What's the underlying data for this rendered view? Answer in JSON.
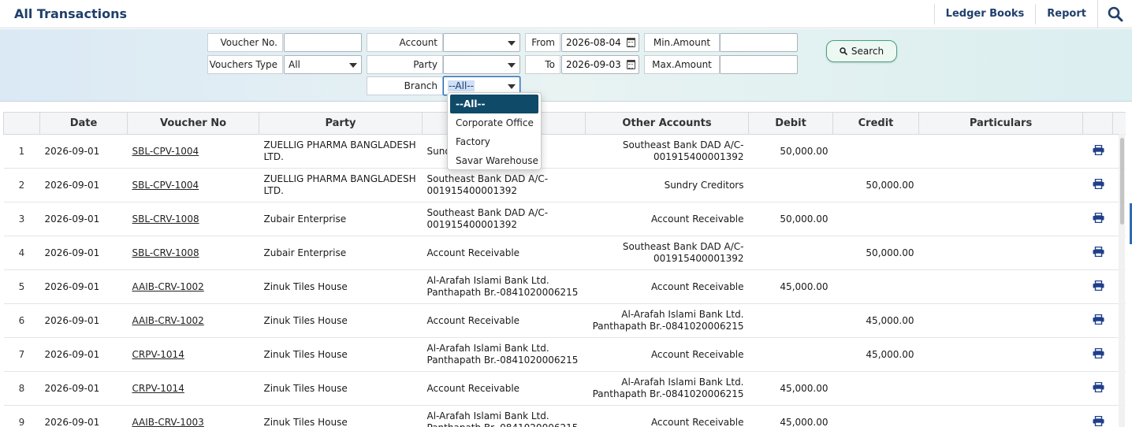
{
  "header": {
    "title": "All Transactions",
    "links": [
      "Ledger Books",
      "Report"
    ]
  },
  "filters": {
    "voucher_no_label": "Voucher No.",
    "voucher_no_value": "",
    "vouchers_type_label": "Vouchers Type",
    "vouchers_type_value": "All",
    "account_label": "Account",
    "account_value": "",
    "party_label": "Party",
    "party_value": "",
    "branch_label": "Branch",
    "branch_value": "--All--",
    "from_label": "From",
    "from_value": "2026-08-04",
    "to_label": "To",
    "to_value": "2026-09-03",
    "min_amount_label": "Min.Amount",
    "min_amount_value": "",
    "max_amount_label": "Max.Amount",
    "max_amount_value": "",
    "search_label": "Search"
  },
  "branch_dropdown": {
    "options": [
      "--All--",
      "Corporate Office",
      "Factory",
      "Savar Warehouse"
    ],
    "selected_index": 0
  },
  "table": {
    "columns": [
      "",
      "Date",
      "Voucher No",
      "Party",
      "",
      "Other Accounts",
      "Debit",
      "Credit",
      "Particulars",
      ""
    ],
    "rows": [
      {
        "n": "1",
        "date": "2026-09-01",
        "voucher": "SBL-CPV-1004",
        "party": "ZUELLIG PHARMA BANGLADESH LTD.",
        "account": "Sund",
        "other": "Southeast Bank DAD A/C-001915400001392",
        "debit": "50,000.00",
        "credit": "",
        "particulars": ""
      },
      {
        "n": "2",
        "date": "2026-09-01",
        "voucher": "SBL-CPV-1004",
        "party": "ZUELLIG PHARMA BANGLADESH LTD.",
        "account": "Southeast Bank DAD A/C-001915400001392",
        "other": "Sundry Creditors",
        "debit": "",
        "credit": "50,000.00",
        "particulars": ""
      },
      {
        "n": "3",
        "date": "2026-09-01",
        "voucher": "SBL-CRV-1008",
        "party": "Zubair Enterprise",
        "account": "Southeast Bank DAD A/C-001915400001392",
        "other": "Account Receivable",
        "debit": "50,000.00",
        "credit": "",
        "particulars": ""
      },
      {
        "n": "4",
        "date": "2026-09-01",
        "voucher": "SBL-CRV-1008",
        "party": "Zubair Enterprise",
        "account": "Account Receivable",
        "other": "Southeast Bank DAD A/C-001915400001392",
        "debit": "",
        "credit": "50,000.00",
        "particulars": ""
      },
      {
        "n": "5",
        "date": "2026-09-01",
        "voucher": "AAIB-CRV-1002",
        "party": "Zinuk Tiles House",
        "account": "Al-Arafah Islami Bank Ltd. Panthapath Br.-0841020006215",
        "other": "Account Receivable",
        "debit": "45,000.00",
        "credit": "",
        "particulars": ""
      },
      {
        "n": "6",
        "date": "2026-09-01",
        "voucher": "AAIB-CRV-1002",
        "party": "Zinuk Tiles House",
        "account": "Account Receivable",
        "other": "Al-Arafah Islami Bank Ltd. Panthapath Br.-0841020006215",
        "debit": "",
        "credit": "45,000.00",
        "particulars": ""
      },
      {
        "n": "7",
        "date": "2026-09-01",
        "voucher": "CRPV-1014",
        "party": "Zinuk Tiles House",
        "account": "Al-Arafah Islami Bank Ltd. Panthapath Br.-0841020006215",
        "other": "Account Receivable",
        "debit": "",
        "credit": "45,000.00",
        "particulars": ""
      },
      {
        "n": "8",
        "date": "2026-09-01",
        "voucher": "CRPV-1014",
        "party": "Zinuk Tiles House",
        "account": "Account Receivable",
        "other": "Al-Arafah Islami Bank Ltd. Panthapath Br.-0841020006215",
        "debit": "45,000.00",
        "credit": "",
        "particulars": ""
      },
      {
        "n": "9",
        "date": "2026-09-01",
        "voucher": "AAIB-CRV-1003",
        "party": "Zinuk Tiles House",
        "account": "Al-Arafah Islami Bank Ltd. Panthapath Br.-0841020006215",
        "other": "Account Receivable",
        "debit": "45,000.00",
        "credit": "",
        "particulars": ""
      }
    ]
  },
  "icons": {
    "search": "search-icon",
    "calendar": "calendar-icon",
    "printer": "printer-icon"
  },
  "colors": {
    "title": "#1f3f6b",
    "dropdown_active": "#0f4a68",
    "printer": "#1f3f8b"
  }
}
